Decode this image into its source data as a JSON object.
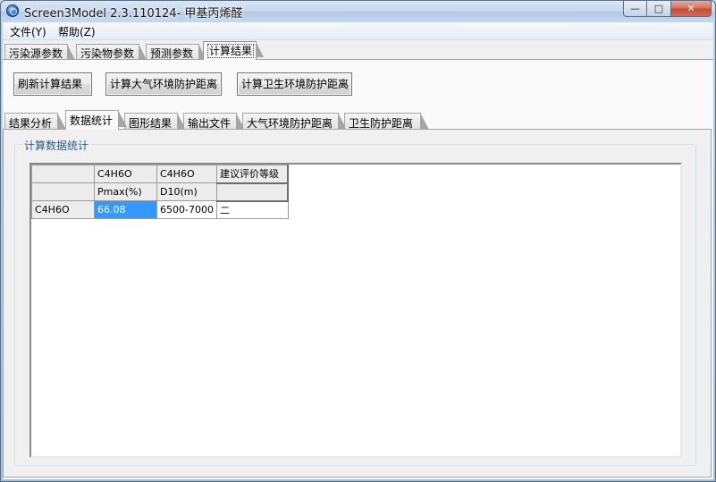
{
  "window": {
    "title": "Screen3Model 2.3.110124- 甲基丙烯醛",
    "controls": {
      "minimize": "—",
      "maximize": "□",
      "close": "✕"
    }
  },
  "menu": [
    "文件(Y)",
    "帮助(Z)"
  ],
  "tabs": [
    "污染源参数",
    "污染物参数",
    "预测参数",
    "计算结果"
  ],
  "active_tab": "计算结果",
  "buttons": {
    "refresh": "刷新计算结果",
    "atmos": "计算大气环境防护距离",
    "health": "计算卫生环境防护距离"
  },
  "inner_tabs": [
    "结果分析",
    "数据统计",
    "图形结果",
    "输出文件",
    "大气环境防护距离",
    "卫生防护距离"
  ],
  "active_inner_tab": "数据统计",
  "group": {
    "label": "计算数据统计"
  },
  "grid": {
    "header_row1": [
      "",
      "C4H6O",
      "C4H6O",
      "建议评价等级"
    ],
    "header_row2": [
      "",
      "Pmax(%)",
      "D10(m)",
      ""
    ],
    "rows": [
      [
        "C4H6O",
        "66.08",
        "6500-7000",
        "二"
      ]
    ]
  },
  "colors": {
    "selection": "#3399ff",
    "group_label": "#1e5aa0"
  }
}
